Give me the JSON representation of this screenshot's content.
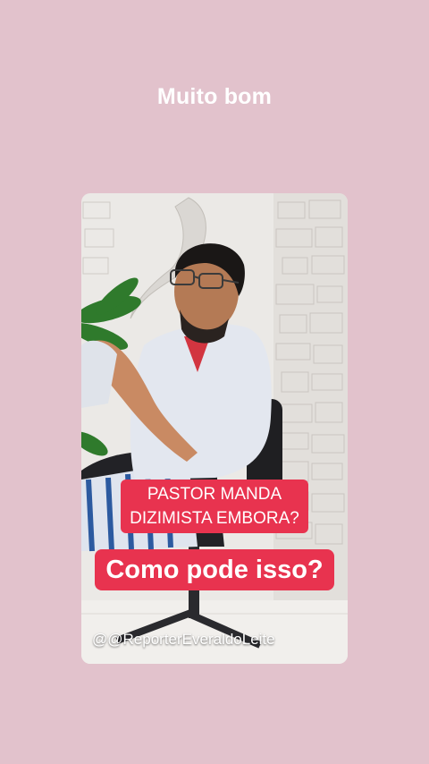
{
  "story": {
    "caption": "Muito bom"
  },
  "video": {
    "headline_line1": "PASTOR MANDA",
    "headline_line2": "DIZIMISTA EMBORA?",
    "subheadline": "Como pode isso?",
    "handle": "@@ReporterEveraldoLeite"
  },
  "colors": {
    "background": "#e2c2cc",
    "pill": "#e8334f",
    "text": "#ffffff"
  }
}
